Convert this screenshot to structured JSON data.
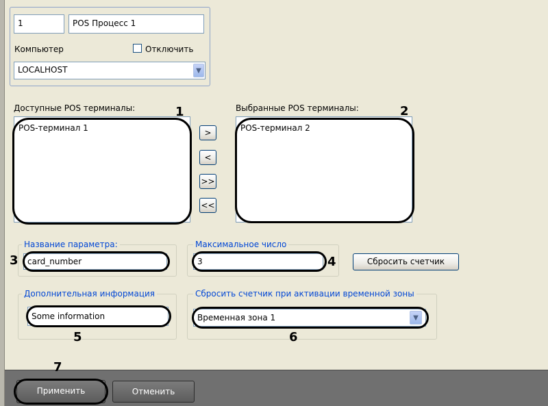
{
  "object": {
    "id": "1",
    "name": "POS Процесс 1",
    "computer_label": "Компьютер",
    "disable_label": "Отключить",
    "computer_value": "LOCALHOST"
  },
  "terminals": {
    "available_label": "Доступные POS терминалы:",
    "available_items": [
      "POS-терминал 1"
    ],
    "selected_label": "Выбранные POS терминалы:",
    "selected_items": [
      "POS-терминал 2"
    ],
    "move_right": ">",
    "move_left": "<",
    "move_all_right": ">>",
    "move_all_left": "<<"
  },
  "params": {
    "param_name_label": "Название параметра:",
    "param_name_value": "card_number",
    "max_number_label": "Максимальное число",
    "max_number_value": "3",
    "reset_counter_button": "Сбросить счетчик",
    "extra_info_label": "Дополнительная информация",
    "extra_info_value": "Some information",
    "reset_on_zone_label": "Сбросить счетчик при активации временной зоны",
    "time_zone_value": "Временная зона 1"
  },
  "footer": {
    "apply": "Применить",
    "cancel": "Отменить"
  },
  "markers": [
    "1",
    "2",
    "3",
    "4",
    "5",
    "6",
    "7"
  ]
}
